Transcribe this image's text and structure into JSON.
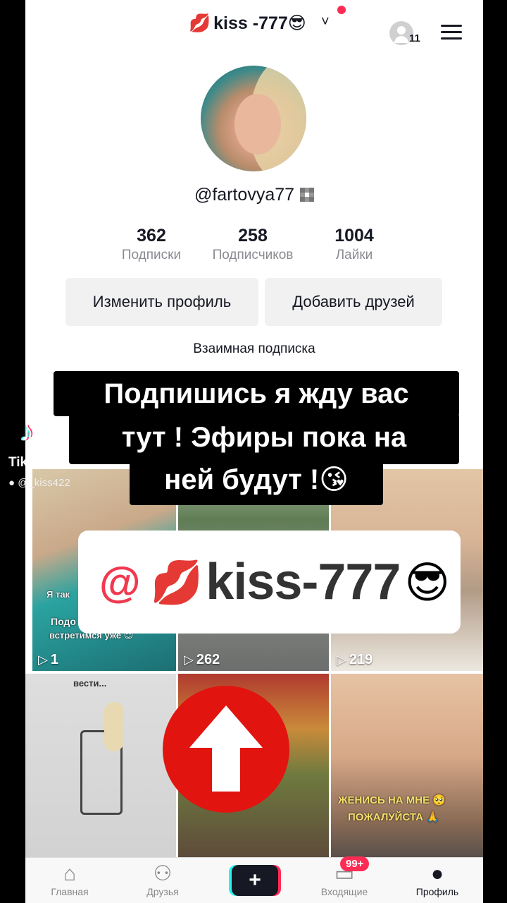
{
  "header": {
    "account_name": "kiss -777😎",
    "account_lips": "💋",
    "chevron": "˅",
    "friend_requests_count": "11"
  },
  "profile": {
    "username": "@fartovya77",
    "stats": [
      {
        "value": "362",
        "label": "Подписки"
      },
      {
        "value": "258",
        "label": "Подписчиков"
      },
      {
        "value": "1004",
        "label": "Лайки"
      }
    ],
    "edit_button": "Изменить профиль",
    "add_friends_button": "Добавить друзей",
    "mutual_label": "Взаимная подписка"
  },
  "grid": {
    "tiles": [
      {
        "views": "1",
        "caption_1": "Я так",
        "caption_2": "Подо",
        "caption_3": "встретимся уже 😊"
      },
      {
        "views": "262",
        "caption_1": "",
        "caption_2": "",
        "caption_3": ""
      },
      {
        "views": "219",
        "caption_1": "",
        "caption_2": "",
        "caption_3": ""
      },
      {
        "views": "",
        "caption_1": "вести...",
        "caption_2": "",
        "caption_3": ""
      },
      {
        "views": "",
        "caption_1": "",
        "caption_2": "",
        "caption_3": ""
      },
      {
        "views": "",
        "caption_1": "ЖЕНИСЬ НА МНЕ 🥺",
        "caption_2": "ПОЖАЛУЙСТА 🙏",
        "caption_3": ""
      }
    ]
  },
  "bottom_nav": {
    "home": "Главная",
    "friends": "Друзья",
    "plus": "+",
    "inbox": "Входящие",
    "inbox_badge": "99+",
    "profile": "Профиль"
  },
  "overlay": {
    "watermark": "TikTok",
    "watermark_handle": "@_kiss422",
    "caption_line1": "Подпишись я жду вас",
    "caption_line2": "тут ! Эфиры пока на",
    "caption_line3": "ней будут !😘",
    "tag_at": "@",
    "tag_lips": "💋",
    "tag_name": "kiss-777",
    "tag_emoji": "😎"
  },
  "colors": {
    "accent_red": "#fe2c55",
    "arrow_red": "#e1140f",
    "tiktok_cyan": "#25f4ee"
  }
}
